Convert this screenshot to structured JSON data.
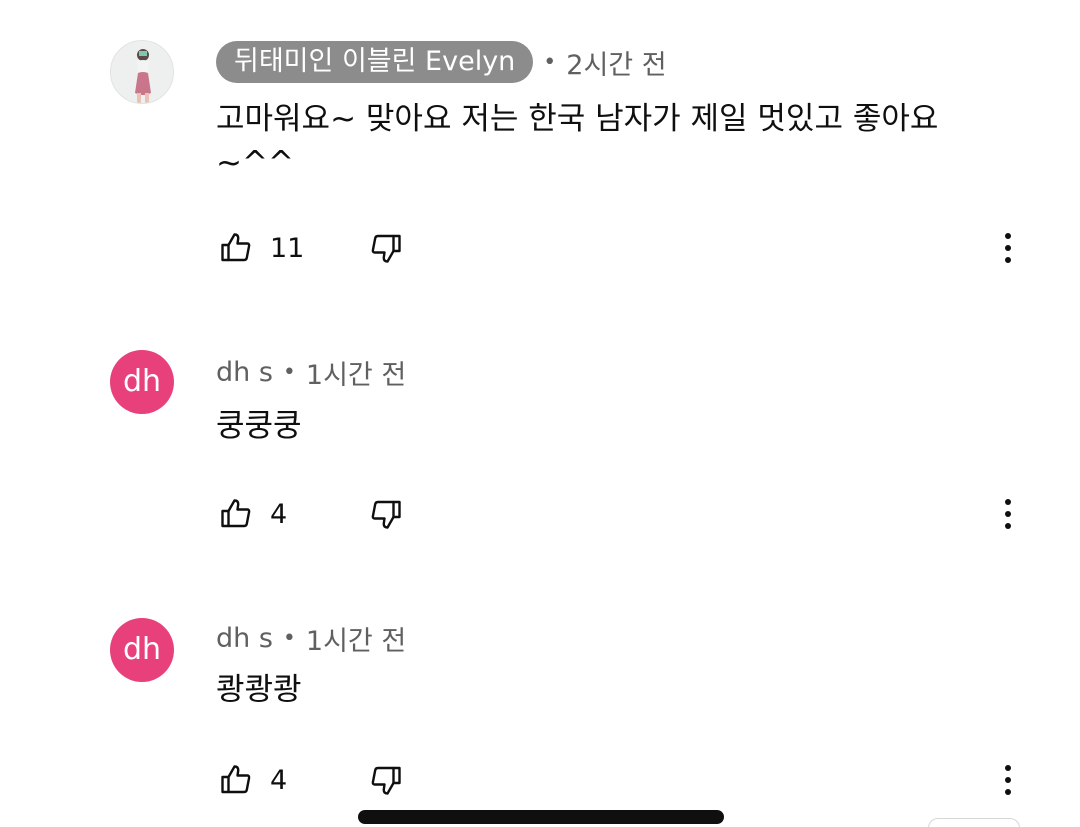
{
  "comments": [
    {
      "author": "뒤태미인 이블린 Evelyn",
      "separator": "•",
      "time": "2시간 전",
      "text": "고마워요~ 맞아요 저는 한국 남자가 제일 멋있고 좋아요 ~^^",
      "likes": "11",
      "avatar_icon": "profile-photo"
    },
    {
      "author": "dh s",
      "avatar_letters": "dh",
      "separator": "•",
      "time": "1시간 전",
      "text": "쿵쿵쿵",
      "likes": "4"
    },
    {
      "author": "dh s",
      "avatar_letters": "dh",
      "separator": "•",
      "time": "1시간 전",
      "text": "쾅쾅쾅",
      "likes": "4"
    }
  ],
  "colors": {
    "avatar_pink": "#e8407a",
    "author_chip": "#8c8c8c",
    "meta_gray": "#606060",
    "text": "#0f0f0f"
  },
  "icons": {
    "like": "thumbs-up-icon",
    "dislike": "thumbs-down-icon",
    "more": "more-vert-icon"
  }
}
